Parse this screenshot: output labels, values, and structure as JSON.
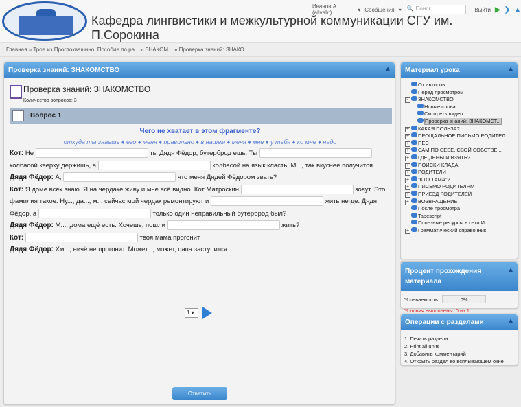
{
  "header": {
    "title": "Кафедра лингвистики и межкультурной коммуникации СГУ им. П.Сорокина",
    "user": "Иванов А. (alivaht)",
    "messages": "Сообщения",
    "search_placeholder": "Поиск",
    "logout": "Выйти"
  },
  "breadcrumb": "Главная » Трое из Простоквашино: Пособие по ра... » ЗНАКОМ... » Проверка знаний: ЗНАКО...",
  "main": {
    "header": "Проверка знаний: ЗНАКОМСТВО",
    "title": "Проверка знаний: ЗНАКОМСТВО",
    "count": "Количество вопросов: 3",
    "question": "Вопрос 1",
    "prompt": "Чего не хватает в этом фрагменте?",
    "words": "откуда ты знаешь ♦ его ♦ меня ♦ правильно ♦ в нашем ♦ меня ♦ мне ♦ у тебя ♦ ко мне ♦ надо",
    "dialog": [
      {
        "s": "Кот:",
        "t1": " Не ",
        "t2": " ты Дядя Фёдор, бутерброд ешь. Ты ",
        "t3": " колбасой кверху держишь, а ",
        "t4": " колбасой на язык класть. М..., так вкуснее получится."
      },
      {
        "s": "Дядя Фёдор:",
        "t1": " А, ",
        "t2": " что меня Дядей Фёдором звать?"
      },
      {
        "s": "Кот:",
        "t1": " Я доме всех знаю. Я на чердаке живу и мне всё видно. Кот Матроскин ",
        "t2": " зовут. Это фамилия такое. Ну..., да..., м... сейчас мой чердак ремонтируют и ",
        "t3": " жить негде. Дядя Фёдор, а ",
        "t4": " только один неправильный бутерброд был?"
      },
      {
        "s": "Дядя Фёдор:",
        "t1": " М.... дома ещё есть. Хочешь, пошли ",
        "t2": " жить?"
      },
      {
        "s": "Кот:",
        "t1": " ",
        "t2": " твоя мама прогонит."
      },
      {
        "s": "Дядя Фёдор:",
        "t1": " Хм..., ничё не прогонит. Может..., может, папа заступится."
      }
    ],
    "page": "1",
    "answer": "Ответить"
  },
  "material": {
    "header": "Материал урока",
    "items": [
      "От авторов",
      "Перед просмотром",
      "ЗНАКОМСТВО",
      "Новые слова",
      "Смотреть видео",
      "Проверка знаний: ЗНАКОМСТ...",
      "КАКАЯ ПОЛЬЗА?",
      "ПРОЩАЛЬНОЕ ПИСЬМО РОДИТЕЛ...",
      "ПЁС",
      "САМ ПО СЕБЕ, СВОЙ СОБСТВЕ...",
      "ГДЕ ДЕНЬГИ ВЗЯТЬ?",
      "ПОИСКИ КЛАДА",
      "РОДИТЕЛИ",
      "\"КТО ТАМА\"?",
      "ПИСЬМО РОДИТЕЛЯМ",
      "ПРИЕЗД РОДИТЕЛЕЙ",
      "ВОЗВРАЩЕНИЕ",
      "После просмотра",
      "Tapescript",
      "Полезные ресурсы в сети И...",
      "Грамматический справочник"
    ]
  },
  "progress": {
    "header": "Процент прохождения материала",
    "label": "Успеваемость:",
    "value": "0%",
    "conditions": "Условия выполнены: 0 из 1"
  },
  "ops": {
    "header": "Операции с разделами",
    "items": [
      "1. Печать раздела",
      "2. Print all units",
      "3. Добавить комментарий",
      "4. Открыть раздел во всплывающем окне"
    ]
  }
}
